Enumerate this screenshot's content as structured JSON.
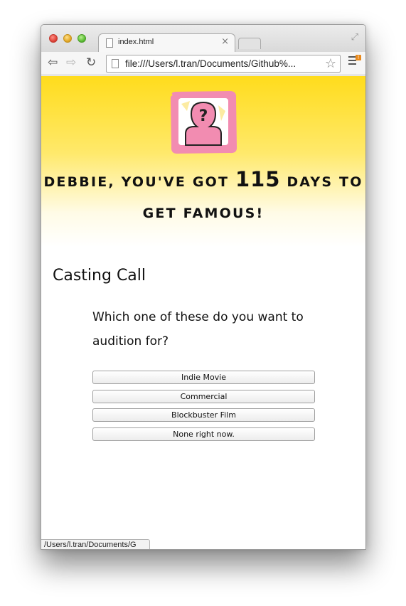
{
  "browser": {
    "tab_title": "index.html",
    "tab_close": "×",
    "url": "file:///Users/l.tran/Documents/Github%...",
    "status_url": "/Users/l.tran/Documents/G",
    "menu_badge": "!"
  },
  "hero": {
    "headline_part1": "DEBBIE, YOU'VE GOT ",
    "days": "115",
    "headline_part2": " DAYS TO GET FAMOUS!",
    "avatar_bg_color": "#f28cb1"
  },
  "casting": {
    "title": "Casting Call",
    "question": "Which one of these do you want to audition for?",
    "options": [
      "Indie Movie",
      "Commercial",
      "Blockbuster Film",
      "None right now."
    ]
  },
  "colors": {
    "hero_top": "#ffdc1c",
    "avatar_pink": "#f28cb1"
  }
}
